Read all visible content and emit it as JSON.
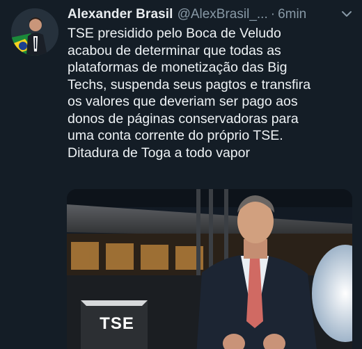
{
  "tweet": {
    "author_name": "Alexander Brasil",
    "author_handle": "@AlexBrasil_...",
    "separator": "·",
    "timestamp": "6min",
    "menu_icon": "chevron-down-icon",
    "text_lines": [
      "TSE presidido pelo Boca de Veludo",
      "acabou de determinar que todas as",
      "plataformas de monetização das Big",
      "Techs, suspenda seus pagtos e transfira",
      "os valores que deveriam ser pago aos",
      "donos de páginas conservadoras para",
      "uma conta corrente do próprio TSE.",
      "Ditadura de Toga a todo vapor"
    ],
    "media": {
      "sign_text": "TSE"
    }
  },
  "colors": {
    "background": "#141d26",
    "text_primary": "#eef2f5",
    "text_secondary": "#8899a6"
  }
}
